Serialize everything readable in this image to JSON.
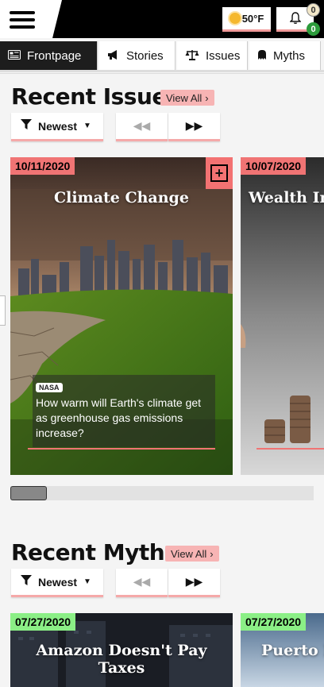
{
  "header": {
    "weather": "50°F",
    "notifications_count": "0",
    "messages_count": "0"
  },
  "nav": [
    {
      "label": "Frontpage",
      "icon": "newspaper-icon",
      "active": true
    },
    {
      "label": "Stories",
      "icon": "megaphone-icon",
      "active": false
    },
    {
      "label": "Issues",
      "icon": "scales-icon",
      "active": false
    },
    {
      "label": "Myths",
      "icon": "ghost-icon",
      "active": false
    }
  ],
  "recent_issues": {
    "title": "Recent Issues",
    "view_all": "View All",
    "sort_label": "Newest",
    "cards": [
      {
        "date": "10/11/2020",
        "title": "Climate Change",
        "source": "NASA",
        "caption": "How warm will Earth's climate get as greenhouse gas emissions increase?"
      },
      {
        "date": "10/07/2020",
        "title": "Wealth Ine"
      }
    ]
  },
  "recent_myths": {
    "title": "Recent Myths",
    "view_all": "View All",
    "sort_label": "Newest",
    "cards": [
      {
        "date": "07/27/2020",
        "title": "Amazon Doesn't Pay Taxes"
      },
      {
        "date": "07/27/2020",
        "title": "Puerto R"
      }
    ]
  },
  "colors": {
    "accent": "#f07474",
    "myth_badge": "#8bef86"
  }
}
